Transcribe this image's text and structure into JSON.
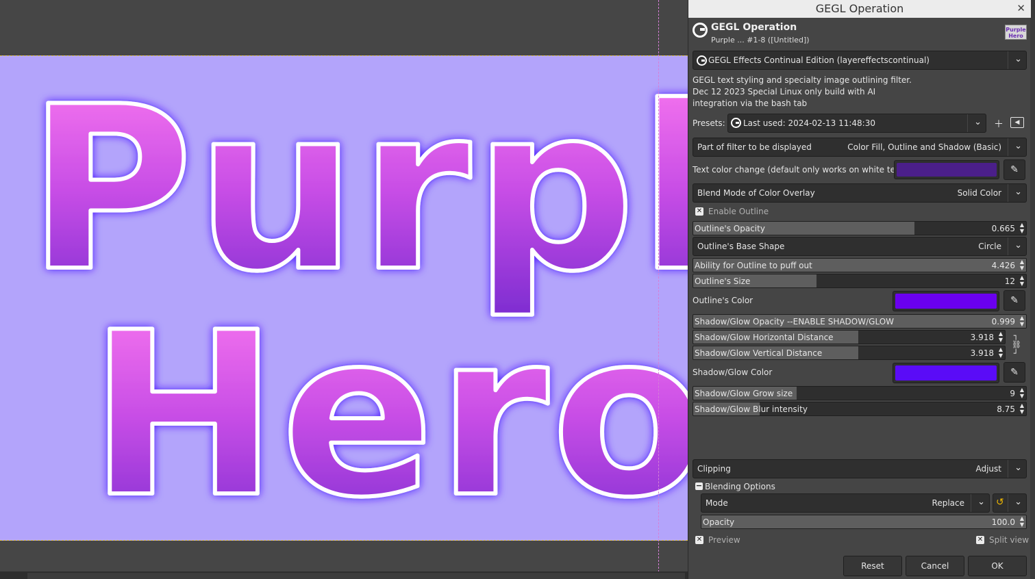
{
  "canvas": {
    "image_text_line1": "Purple",
    "image_text_line2": "Hero",
    "background_color": "#b3a4fb"
  },
  "dialog": {
    "window_title": "GEGL Operation",
    "op_title": "GEGL Operation",
    "op_subtitle": "Purple ... #1-8 ([Untitled])",
    "thumb_text_1": "Purple",
    "thumb_text_2": "Hero",
    "filter_combo": "GEGL Effects Continual Edition (layereffectscontinual)",
    "description": "GEGL text styling and specialty image outlining filter. Dec 12 2023 Special Linux only build with AI integration via the bash tab",
    "presets_label": "Presets:",
    "presets_value": "Last used: 2024-02-13 11:48:30",
    "part_label": "Part of filter to be displayed",
    "part_value": "Color Fill, Outline and Shadow (Basic)",
    "text_color_label": "Text color change (default only works on white text.)",
    "text_color": "#4b1f8a",
    "blend_overlay_label": "Blend Mode of Color Overlay",
    "blend_overlay_value": "Solid Color",
    "enable_outline_label": "Enable Outline",
    "outline_opacity": {
      "label": "Outline's Opacity",
      "value": "0.665",
      "fraction": 0.665
    },
    "outline_shape_label": "Outline's Base Shape",
    "outline_shape_value": "Circle",
    "outline_puff": {
      "label": "Ability for Outline to puff out",
      "value": "4.426",
      "fraction": 1.0
    },
    "outline_size": {
      "label": "Outline's Size",
      "value": "12",
      "fraction": 0.37
    },
    "outline_color_label": "Outline's Color",
    "outline_color": "#6a00ee",
    "shadow_opacity": {
      "label": "Shadow/Glow Opacity --ENABLE SHADOW/GLOW",
      "value": "0.999",
      "fraction": 0.999
    },
    "shadow_hdist": {
      "label": "Shadow/Glow Horizontal Distance",
      "value": "3.918",
      "fraction": 0.53
    },
    "shadow_vdist": {
      "label": "Shadow/Glow Vertical Distance",
      "value": "3.918",
      "fraction": 0.53
    },
    "shadow_color_label": "Shadow/Glow Color",
    "shadow_color": "#5a0cf7",
    "shadow_grow": {
      "label": "Shadow/Glow Grow size",
      "value": "9",
      "fraction": 0.31
    },
    "shadow_blur": {
      "label": "Shadow/Glow Blur intensity",
      "value": "8.75",
      "fraction": 0.2
    },
    "clipping_label": "Clipping",
    "clipping_value": "Adjust",
    "blending_options_label": "Blending Options",
    "mode_label": "Mode",
    "mode_value": "Replace",
    "opacity": {
      "label": "Opacity",
      "value": "100.0",
      "fraction": 1.0
    },
    "preview_label": "Preview",
    "split_view_label": "Split view",
    "reset_label": "Reset",
    "cancel_label": "Cancel",
    "ok_label": "OK"
  }
}
